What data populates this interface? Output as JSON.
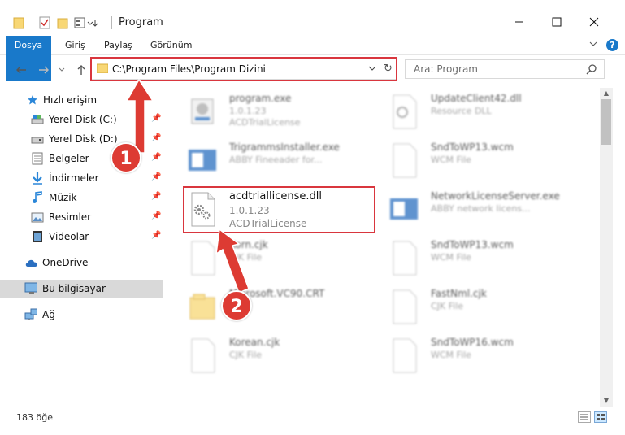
{
  "window": {
    "title": "Program"
  },
  "ribbon": {
    "tabs": [
      {
        "label": "Dosya"
      },
      {
        "label": "Giriş"
      },
      {
        "label": "Paylaş"
      },
      {
        "label": "Görünüm"
      }
    ]
  },
  "address": {
    "path": "C:\\Program Files\\Program Dizini"
  },
  "search": {
    "placeholder": "Ara: Program"
  },
  "nav": {
    "quick_access": "Hızlı erişim",
    "items": [
      {
        "label": "Yerel Disk (C:)"
      },
      {
        "label": "Yerel Disk (D:)"
      },
      {
        "label": "Belgeler"
      },
      {
        "label": "İndirmeler"
      },
      {
        "label": "Müzik"
      },
      {
        "label": "Resimler"
      },
      {
        "label": "Videolar"
      }
    ],
    "onedrive": "OneDrive",
    "this_pc": "Bu bilgisayar",
    "network": "Ağ"
  },
  "files": [
    {
      "name": "program.exe",
      "line2": "1.0.1.23",
      "line3": "ACDTrialLicense"
    },
    {
      "name": "UpdateClient42.dll",
      "line2": "Resource DLL",
      "line3": ""
    },
    {
      "name": "TrigrammsInstaller.exe",
      "line2": "ABBY Fineeader for...",
      "line3": ""
    },
    {
      "name": "SndToWP13.wcm",
      "line2": "WCM File",
      "line3": ""
    },
    {
      "name": "acdtriallicense.dll",
      "line2": "1.0.1.23",
      "line3": "ACDTrialLicense"
    },
    {
      "name": "NetworkLicenseServer.exe",
      "line2": "ABBY network licens...",
      "line3": ""
    },
    {
      "name": "Korn.cjk",
      "line2": "CJK File",
      "line3": ""
    },
    {
      "name": "SndToWP13.wcm",
      "line2": "WCM File",
      "line3": ""
    },
    {
      "name": "Microsoft.VC90.CRT",
      "line2": "",
      "line3": ""
    },
    {
      "name": "FastNml.cjk",
      "line2": "CJK File",
      "line3": ""
    },
    {
      "name": "Korean.cjk",
      "line2": "CJK File",
      "line3": ""
    },
    {
      "name": "SndToWP16.wcm",
      "line2": "WCM File",
      "line3": ""
    }
  ],
  "status": {
    "count": "183 öğe"
  },
  "markers": {
    "one": "1",
    "two": "2"
  },
  "colors": {
    "accent": "#1979ca",
    "highlight": "#d9363e",
    "marker": "#dd3b33"
  }
}
